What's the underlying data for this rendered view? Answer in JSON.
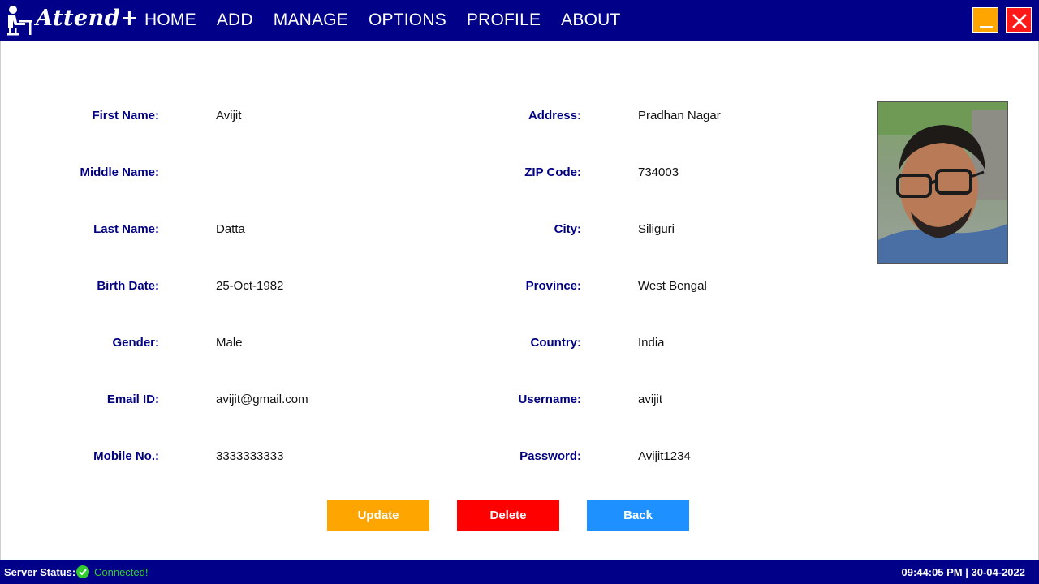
{
  "app": {
    "name": "Attend+"
  },
  "nav": {
    "items": [
      "HOME",
      "ADD",
      "MANAGE",
      "OPTIONS",
      "PROFILE",
      "ABOUT"
    ]
  },
  "colors": {
    "titlebar": "#000088",
    "label": "#000080",
    "update": "#ffa500",
    "delete": "#ff0000",
    "back": "#1e90ff",
    "connected": "#33cc33"
  },
  "left_fields": [
    {
      "label": "First Name:",
      "value": "Avijit"
    },
    {
      "label": "Middle Name:",
      "value": ""
    },
    {
      "label": "Last Name:",
      "value": "Datta"
    },
    {
      "label": "Birth Date:",
      "value": "25-Oct-1982"
    },
    {
      "label": "Gender:",
      "value": "Male"
    },
    {
      "label": "Email ID:",
      "value": "avijit@gmail.com"
    },
    {
      "label": "Mobile No.:",
      "value": "3333333333"
    }
  ],
  "right_fields": [
    {
      "label": "Address:",
      "value": "Pradhan Nagar"
    },
    {
      "label": "ZIP Code:",
      "value": "734003"
    },
    {
      "label": "City:",
      "value": "Siliguri"
    },
    {
      "label": "Province:",
      "value": "West Bengal"
    },
    {
      "label": "Country:",
      "value": "India"
    },
    {
      "label": "Username:",
      "value": "avijit"
    },
    {
      "label": "Password:",
      "value": "Avijit1234"
    }
  ],
  "buttons": {
    "update": "Update",
    "delete": "Delete",
    "back": "Back"
  },
  "status": {
    "label": "Server Status:",
    "value": "Connected!",
    "datetime": "09:44:05 PM | 30-04-2022"
  },
  "icons": {
    "logo": "person-at-desk-icon",
    "minimize": "minimize-icon",
    "close": "close-icon",
    "status": "check-circle-icon"
  }
}
